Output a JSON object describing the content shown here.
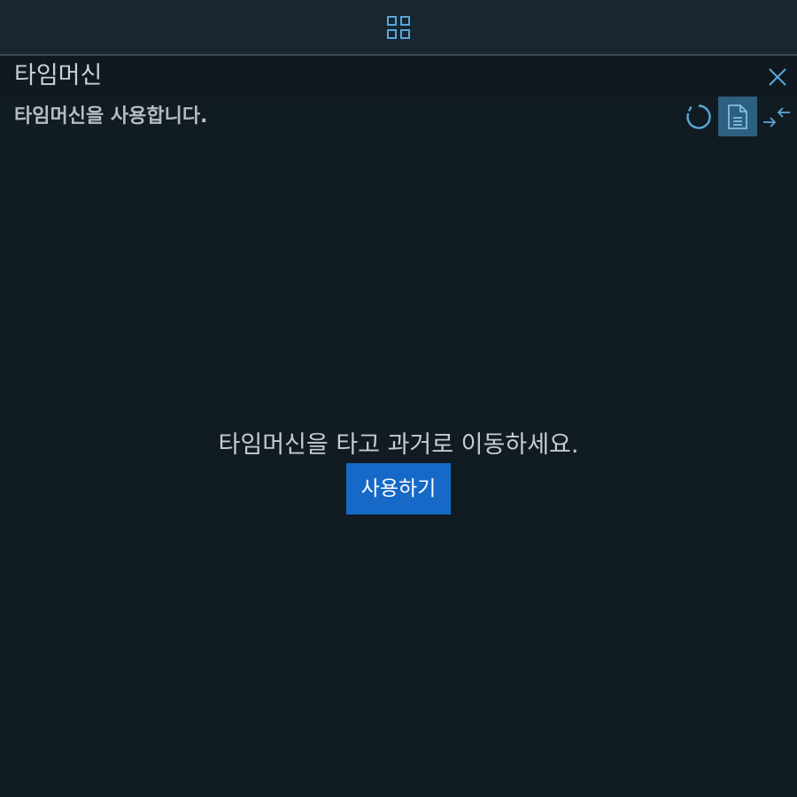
{
  "topbar": {
    "apps_icon": "grid-icon"
  },
  "panel": {
    "title": "타임머신",
    "close_icon": "close-icon"
  },
  "toolbar": {
    "status_text": "타임머신을 사용합니다.",
    "refresh_icon": "refresh-icon",
    "document_icon": "document-icon",
    "collapse_icon": "collapse-arrows-icon"
  },
  "main": {
    "message": "타임머신을 타고 과거로 이동하세요.",
    "use_button_label": "사용하기"
  },
  "colors": {
    "accent": "#1769c7",
    "icon": "#5aa6d6",
    "active_tool_bg": "#2d5f7e",
    "background": "#111b22"
  }
}
